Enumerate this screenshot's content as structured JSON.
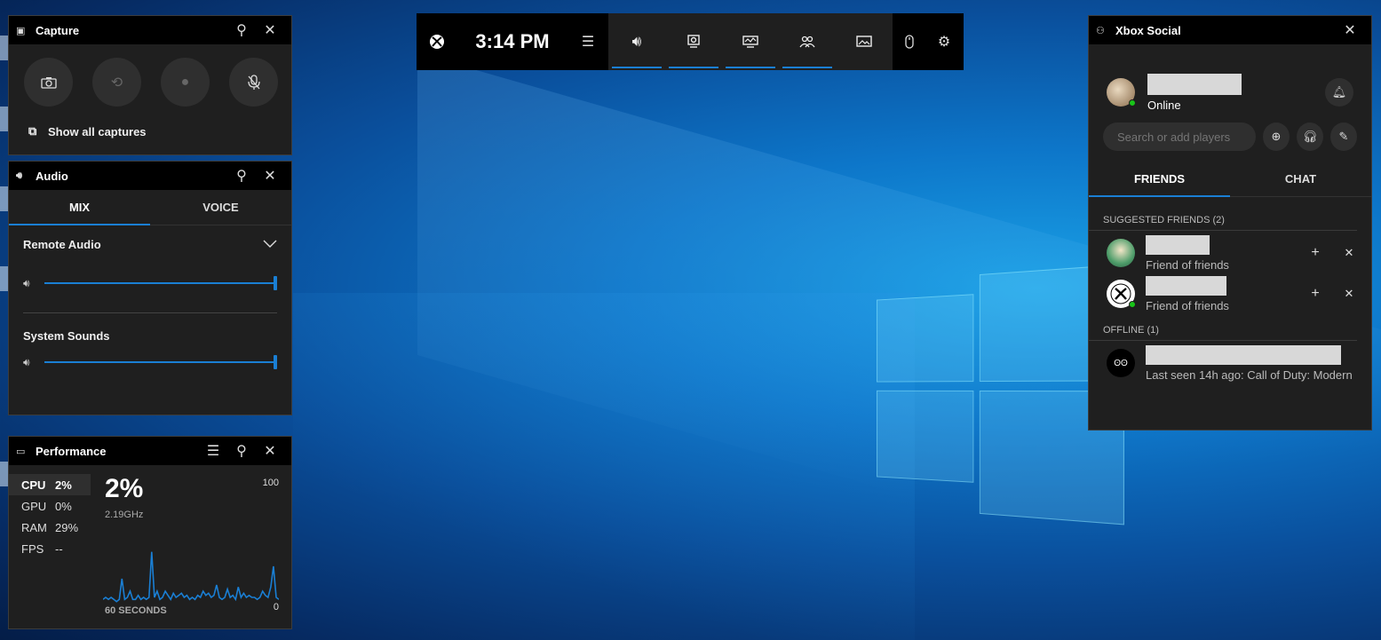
{
  "topbar": {
    "time": "3:14 PM",
    "widgets": [
      "audio",
      "capture",
      "performance",
      "social",
      "gallery"
    ]
  },
  "capture": {
    "title": "Capture",
    "show_all": "Show all captures"
  },
  "audio": {
    "title": "Audio",
    "tabs": [
      "MIX",
      "VOICE"
    ],
    "devices": [
      {
        "label": "Remote Audio",
        "level": 1.0
      },
      {
        "label": "System Sounds",
        "level": 1.0
      }
    ]
  },
  "performance": {
    "title": "Performance",
    "items": [
      {
        "name": "CPU",
        "value": "2%"
      },
      {
        "name": "GPU",
        "value": "0%"
      },
      {
        "name": "RAM",
        "value": "29%"
      },
      {
        "name": "FPS",
        "value": "--"
      }
    ],
    "big_value": "2%",
    "freq": "2.19GHz",
    "max": "100",
    "min": "0",
    "axis": "60 SECONDS",
    "series": [
      2,
      3,
      2,
      3,
      2,
      1,
      2,
      12,
      2,
      3,
      6,
      2,
      2,
      4,
      2,
      3,
      2,
      3,
      25,
      3,
      6,
      2,
      3,
      6,
      4,
      2,
      5,
      3,
      4,
      5,
      3,
      4,
      2,
      3,
      2,
      4,
      3,
      6,
      4,
      5,
      3,
      4,
      9,
      3,
      2,
      3,
      7,
      3,
      4,
      2,
      8,
      3,
      5,
      3,
      4,
      3,
      3,
      2,
      3,
      6,
      4,
      3,
      8,
      18,
      3,
      2
    ]
  },
  "social": {
    "title": "Xbox Social",
    "status": "Online",
    "search_placeholder": "Search or add players",
    "tabs": [
      "FRIENDS",
      "CHAT"
    ],
    "suggested_header": "SUGGESTED FRIENDS  (2)",
    "suggested": [
      {
        "sub": "Friend of friends"
      },
      {
        "sub": "Friend of friends"
      }
    ],
    "offline_header": "OFFLINE   (1)",
    "offline": [
      {
        "sub": "Last seen 14h ago: Call of Duty: Modern"
      }
    ]
  }
}
